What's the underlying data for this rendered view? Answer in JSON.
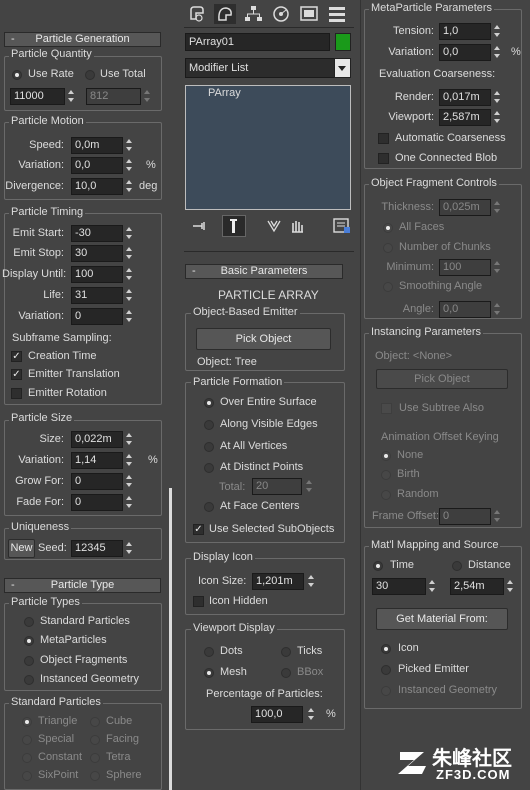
{
  "left": {
    "pg": {
      "title": "Particle Generation",
      "minus": "-",
      "quantity_title": "Particle Quantity",
      "use_rate": "Use Rate",
      "use_total": "Use Total",
      "rate": "11000",
      "total": "812",
      "motion_title": "Particle Motion",
      "speed_l": "Speed:",
      "speed": "0,0m",
      "variation_l": "Variation:",
      "variation": "0,0",
      "pct": "%",
      "divergence_l": "Divergence:",
      "divergence": "10,0",
      "deg": "deg",
      "timing_title": "Particle Timing",
      "emit_start_l": "Emit Start:",
      "emit_start": "-30",
      "emit_stop_l": "Emit Stop:",
      "emit_stop": "30",
      "display_until_l": "Display Until:",
      "display_until": "100",
      "life_l": "Life:",
      "life": "31",
      "life_var_l": "Variation:",
      "life_var": "0",
      "subframe_l": "Subframe Sampling:",
      "creation_time": "Creation Time",
      "emitter_translation": "Emitter Translation",
      "emitter_rotation": "Emitter Rotation",
      "size_title": "Particle Size",
      "size_l": "Size:",
      "size": "0,022m",
      "size_var_l": "Variation:",
      "size_var": "1,14",
      "grow_l": "Grow For:",
      "grow": "0",
      "fade_l": "Fade For:",
      "fade": "0",
      "uniq_title": "Uniqueness",
      "new": "New",
      "seed_l": "Seed:",
      "seed": "12345"
    },
    "pt": {
      "title": "Particle Type",
      "minus": "-",
      "types_title": "Particle Types",
      "standard": "Standard Particles",
      "meta": "MetaParticles",
      "fragments": "Object Fragments",
      "instanced": "Instanced Geometry",
      "std_title": "Standard Particles",
      "triangle": "Triangle",
      "cube": "Cube",
      "special": "Special",
      "facing": "Facing",
      "constant": "Constant",
      "tetra": "Tetra",
      "sixpoint": "SixPoint",
      "sphere": "Sphere"
    }
  },
  "mid": {
    "name": "PArray01",
    "modifier_list": "Modifier List",
    "stack_item": "PArray",
    "bp": {
      "title": "Basic Parameters",
      "minus": "-",
      "heading": "PARTICLE ARRAY",
      "obe_title": "Object-Based Emitter",
      "pick": "Pick Object",
      "object_l": "Object: Tree",
      "pf_title": "Particle Formation",
      "over_surface": "Over Entire Surface",
      "visible_edges": "Along Visible Edges",
      "all_vertices": "At All Vertices",
      "distinct_points": "At Distinct Points",
      "total_l": "Total:",
      "total": "20",
      "face_centers": "At Face Centers",
      "use_selected": "Use Selected SubObjects",
      "di_title": "Display Icon",
      "icon_size_l": "Icon Size:",
      "icon_size": "1,201m",
      "icon_hidden": "Icon Hidden",
      "vd_title": "Viewport Display",
      "dots": "Dots",
      "ticks": "Ticks",
      "mesh": "Mesh",
      "bbox": "BBox",
      "pct_l": "Percentage of Particles:",
      "pct": "100,0",
      "pct_u": "%"
    }
  },
  "right": {
    "meta": {
      "title": "MetaParticle Parameters",
      "tension_l": "Tension:",
      "tension": "1,0",
      "variation_l": "Variation:",
      "variation": "0,0",
      "pct": "%",
      "eval_l": "Evaluation Coarseness:",
      "render_l": "Render:",
      "render": "0,017m",
      "viewport_l": "Viewport:",
      "viewport": "2,587m",
      "auto": "Automatic Coarseness",
      "one_blob": "One Connected Blob"
    },
    "frag": {
      "title": "Object Fragment Controls",
      "thickness_l": "Thickness:",
      "thickness": "0,025m",
      "all_faces": "All Faces",
      "chunks": "Number of Chunks",
      "minimum_l": "Minimum:",
      "minimum": "100",
      "smoothing": "Smoothing Angle",
      "angle_l": "Angle:",
      "angle": "0,0"
    },
    "inst": {
      "title": "Instancing Parameters",
      "object_l": "Object: <None>",
      "pick": "Pick Object",
      "use_subtree": "Use Subtree Also",
      "anim_l": "Animation Offset Keying",
      "none": "None",
      "birth": "Birth",
      "random": "Random",
      "offset_l": "Frame Offset:",
      "offset": "0"
    },
    "mat": {
      "title": "Mat'l Mapping and Source",
      "time": "Time",
      "distance": "Distance",
      "time_v": "30",
      "dist_v": "2,54m",
      "get": "Get Material From:",
      "icon": "Icon",
      "picked": "Picked Emitter",
      "inst_geo": "Instanced Geometry"
    }
  },
  "watermark": {
    "cn": "朱峰社区",
    "url": "ZF3D.COM"
  },
  "colors": {
    "object_color": "#1a9a1a",
    "panel": "#444444",
    "field": "#262626"
  }
}
